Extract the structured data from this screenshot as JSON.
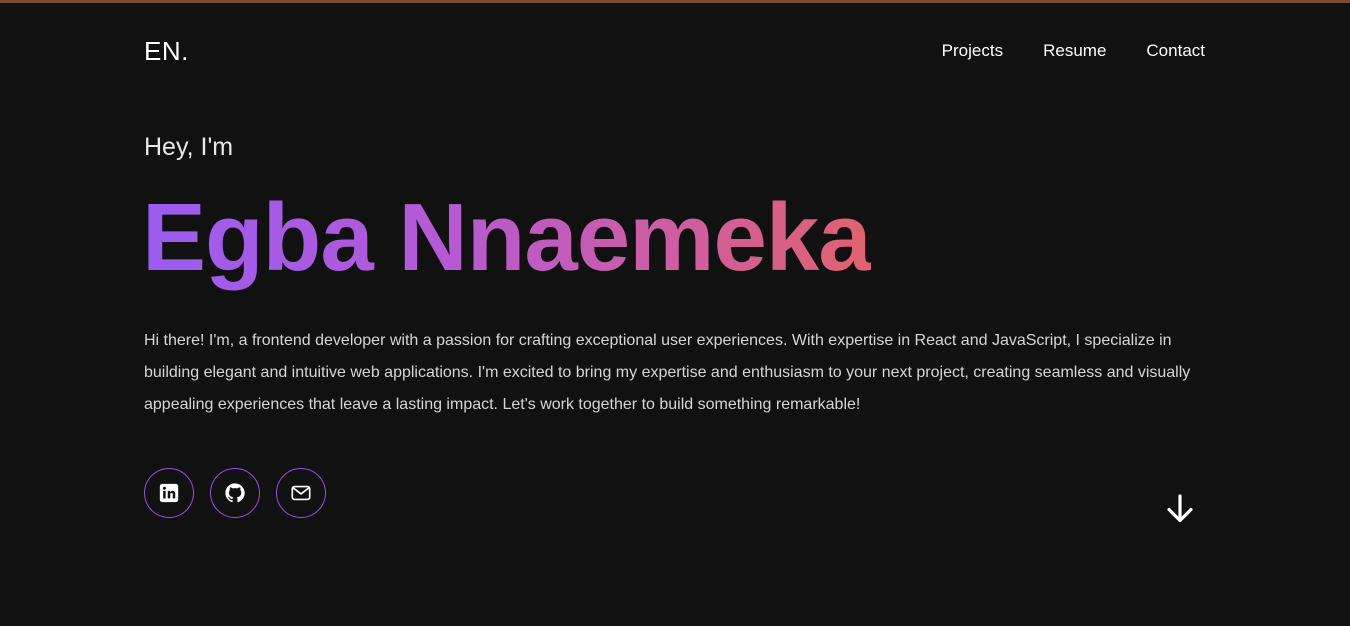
{
  "header": {
    "logo": "EN.",
    "nav": [
      {
        "label": "Projects"
      },
      {
        "label": "Resume"
      },
      {
        "label": "Contact"
      }
    ]
  },
  "hero": {
    "greeting": "Hey, I'm",
    "name": "Egba Nnaemeka",
    "bio": "Hi there! I'm, a frontend developer with a passion for crafting exceptional user experiences. With expertise in React and JavaScript, I specialize in building elegant and intuitive web applications. I'm excited to bring my expertise and enthusiasm to your next project, creating seamless and visually appealing experiences that leave a lasting impact. Let's work together to build something remarkable!"
  },
  "socials": [
    {
      "icon": "linkedin-icon"
    },
    {
      "icon": "github-icon"
    },
    {
      "icon": "mail-icon"
    }
  ],
  "scroll": {
    "icon": "arrow-down-icon"
  },
  "colors": {
    "background": "#111111",
    "accent_border": "#9b4dea",
    "gradient_start": "#9b5cf0",
    "gradient_end": "#e0626e",
    "top_border": "#7a4a35"
  }
}
